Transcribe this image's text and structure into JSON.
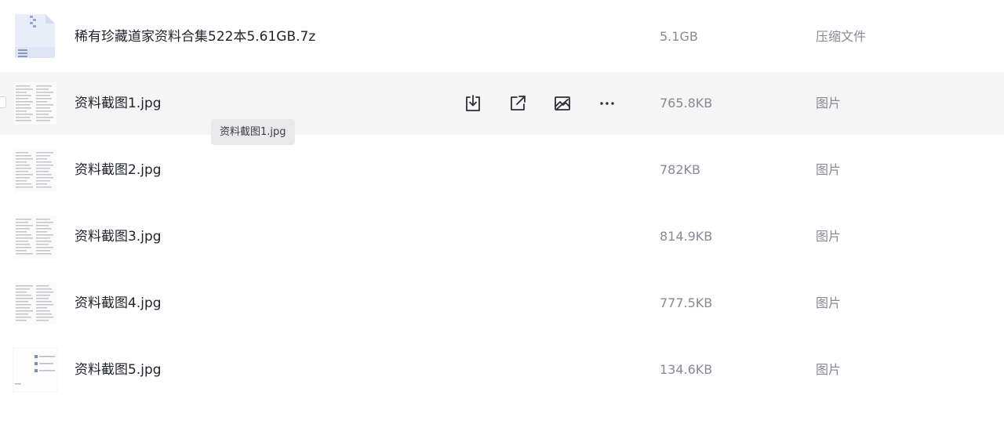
{
  "files": [
    {
      "name": "稀有珍藏道家资料合集522本5.61GB.7z",
      "size": "5.1GB",
      "type": "压缩文件",
      "icon": "archive-file-icon"
    },
    {
      "name": "资料截图1.jpg",
      "size": "765.8KB",
      "type": "图片",
      "icon": "image-thumbnail"
    },
    {
      "name": "资料截图2.jpg",
      "size": "782KB",
      "type": "图片",
      "icon": "image-thumbnail"
    },
    {
      "name": "资料截图3.jpg",
      "size": "814.9KB",
      "type": "图片",
      "icon": "image-thumbnail"
    },
    {
      "name": "资料截图4.jpg",
      "size": "777.5KB",
      "type": "图片",
      "icon": "image-thumbnail"
    },
    {
      "name": "资料截图5.jpg",
      "size": "134.6KB",
      "type": "图片",
      "icon": "image-thumbnail"
    }
  ],
  "hover_actions": [
    {
      "name": "download-icon"
    },
    {
      "name": "share-icon"
    },
    {
      "name": "preview-image-icon"
    },
    {
      "name": "more-icon"
    }
  ],
  "tooltip": {
    "text": "资料截图1.jpg"
  },
  "colors": {
    "hover_row": "#f5f5f6",
    "primary_text": "#1f2329",
    "secondary_text": "#878a92",
    "tooltip_bg": "#e9e9ec"
  }
}
